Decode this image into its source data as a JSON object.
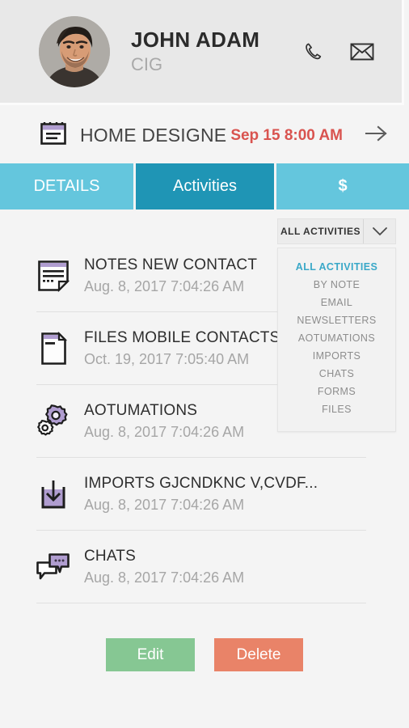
{
  "profile": {
    "name": "JOHN ADAM",
    "subtitle": "CIG",
    "avatar_icon": "user-photo",
    "phone_icon": "phone-icon",
    "email_icon": "envelope-icon"
  },
  "title_row": {
    "calendar_icon": "calendar-icon",
    "title": "HOME DESIGNE",
    "date": "Sep 15 8:00 AM",
    "arrow_icon": "arrow-right-icon"
  },
  "tabs": [
    {
      "label": "DETAILS",
      "active": false
    },
    {
      "label": "Activities",
      "active": true
    },
    {
      "label": "$",
      "active": false
    }
  ],
  "filter": {
    "selected": "ALL ACTIVITIES",
    "caret_icon": "chevron-down-icon",
    "options": [
      "ALL ACTIVITIES",
      "BY NOTE",
      "EMAIL",
      "NEWSLETTERS",
      "AOTUMATIONS",
      "IMPORTS",
      "CHATS",
      "FORMS",
      "FILES"
    ]
  },
  "activities": [
    {
      "icon": "notes-icon",
      "title": "NOTES NEW CONTACT",
      "time": "Aug. 8, 2017 7:04:26 AM"
    },
    {
      "icon": "file-icon",
      "title": "FILES MOBILE CONTACTS...",
      "time": "Oct. 19, 2017 7:05:40 AM"
    },
    {
      "icon": "gears-icon",
      "title": "AOTUMATIONS",
      "time": "Aug. 8, 2017 7:04:26 AM"
    },
    {
      "icon": "download-icon",
      "title": "IMPORTS GJCNDKNC V,CVDF...",
      "time": "Aug. 8, 2017 7:04:26 AM"
    },
    {
      "icon": "chats-icon",
      "title": "CHATS",
      "time": "Aug. 8, 2017 7:04:26 AM"
    }
  ],
  "footer": {
    "edit_label": "Edit",
    "delete_label": "Delete"
  },
  "colors": {
    "page_bg": "#f4f4f4",
    "card_bg": "#e8e8e8",
    "tab_inactive": "#64c6dd",
    "tab_active": "#1f95b5",
    "date_red": "#d9534f",
    "accent_purple": "#b09dd0",
    "edit_green": "#86c793",
    "delete_salmon": "#e98368",
    "filter_selected": "#3aa8c8"
  }
}
